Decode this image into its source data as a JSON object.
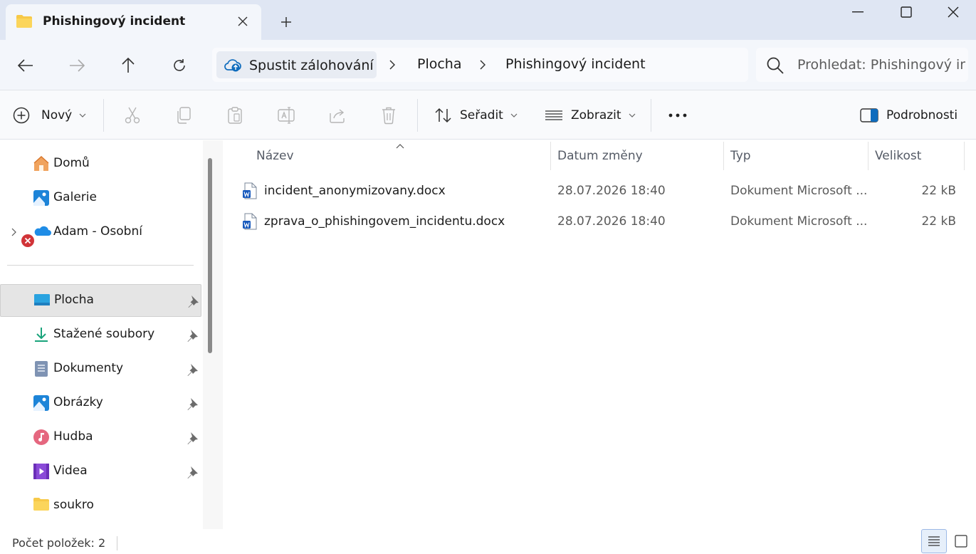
{
  "window": {
    "tab_title": "Phishingový incident",
    "new_tab_symbol": "+"
  },
  "nav": {
    "backup_label": "Spustit zálohování",
    "breadcrumbs": [
      "Plocha",
      "Phishingový incident"
    ],
    "search_placeholder": "Prohledat: Phishingový incident"
  },
  "commands": {
    "new_label": "Nový",
    "sort_label": "Seřadit",
    "view_label": "Zobrazit",
    "more_label": "•••",
    "details_label": "Podrobnosti"
  },
  "sidebar": {
    "top": [
      {
        "label": "Domů",
        "icon": "home-icon"
      },
      {
        "label": "Galerie",
        "icon": "gallery-icon"
      },
      {
        "label": "Adam - Osobní",
        "icon": "onedrive-icon"
      }
    ],
    "quick": [
      {
        "label": "Plocha",
        "icon": "desktop-icon",
        "pinned": true,
        "selected": true
      },
      {
        "label": "Stažené soubory",
        "icon": "download-icon",
        "pinned": true
      },
      {
        "label": "Dokumenty",
        "icon": "documents-icon",
        "pinned": true
      },
      {
        "label": "Obrázky",
        "icon": "pictures-icon",
        "pinned": true
      },
      {
        "label": "Hudba",
        "icon": "music-icon",
        "pinned": true
      },
      {
        "label": "Videa",
        "icon": "videos-icon",
        "pinned": true
      },
      {
        "label": "soukro",
        "icon": "folder-icon",
        "pinned": false
      }
    ]
  },
  "filelist": {
    "columns": [
      "Název",
      "Datum změny",
      "Typ",
      "Velikost"
    ],
    "rows": [
      {
        "name": "incident_anonymizovany.docx",
        "date": "28.07.2026 18:40",
        "type": "Dokument Microsoft ...",
        "size": "22 kB"
      },
      {
        "name": "zprava_o_phishingovem_incidentu.docx",
        "date": "28.07.2026 18:40",
        "type": "Dokument Microsoft ...",
        "size": "22 kB"
      }
    ]
  },
  "status": {
    "item_count": "Počet položek: 2"
  },
  "colors": {
    "titlebar_bg": "#dfe6f3",
    "accent": "#0067c0",
    "selected_bg": "#e5e5e5"
  }
}
